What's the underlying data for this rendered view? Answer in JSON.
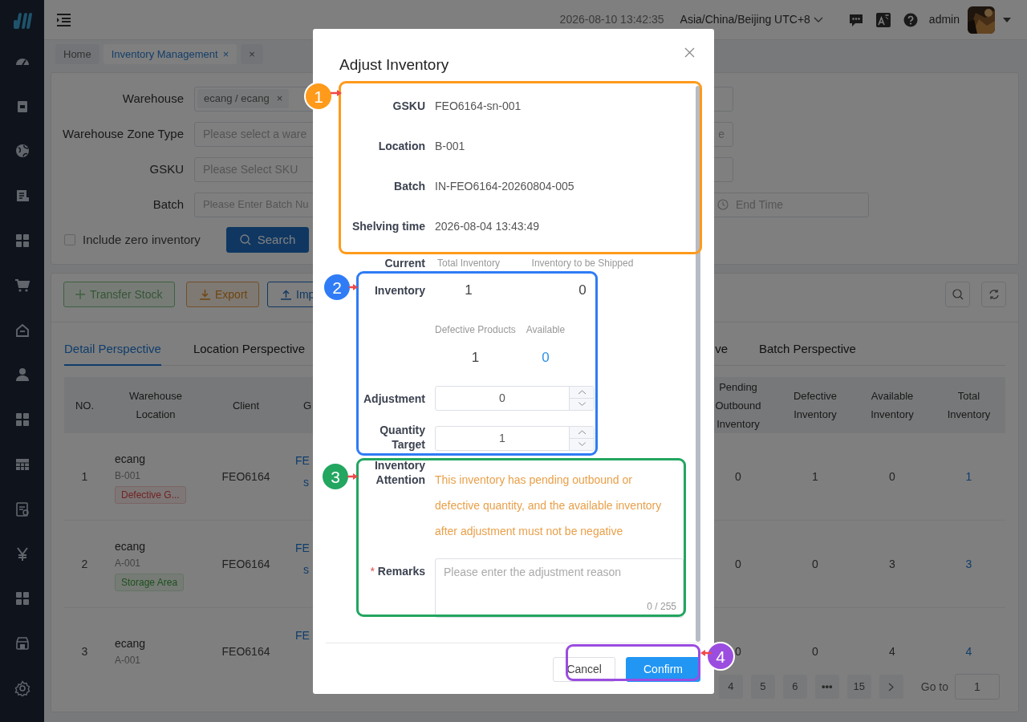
{
  "header": {
    "datetime": "2026-08-10 13:42:35",
    "timezone": "Asia/China/Beijing UTC+8",
    "user": "admin"
  },
  "page_tabs": [
    {
      "label": "Home",
      "selected": false
    },
    {
      "label": "Inventory Management",
      "selected": true,
      "close": "×"
    }
  ],
  "close_all": "×",
  "filters": {
    "fields": [
      {
        "label": "Warehouse",
        "kind": "tags",
        "tags": [
          "ecang / ecang"
        ],
        "tag_close": "×"
      },
      {
        "label": "Warehouse Zone Type",
        "kind": "select",
        "placeholder": "Please select a ware",
        "side_text": "e"
      },
      {
        "label": "GSKU",
        "kind": "select",
        "placeholder": "Please Select SKU"
      },
      {
        "label": "Batch",
        "kind": "date",
        "placeholder": "Please Enter Batch Nu",
        "end_placeholder": "End Time"
      }
    ],
    "include_zero": {
      "label": "Include zero inventory",
      "checked": false
    },
    "search": "Search"
  },
  "toolbar": [
    {
      "label": "Transfer Stock",
      "kind": "add",
      "disabled": true
    },
    {
      "label": "Export",
      "kind": "export",
      "disabled": false
    },
    {
      "label": "Imp",
      "kind": "import",
      "disabled": false
    }
  ],
  "view_tabs": [
    {
      "label": "Detail Perspective",
      "selected": true
    },
    {
      "label": "Location Perspective",
      "selected": false
    },
    {
      "label": "ve",
      "selected": false
    },
    {
      "label": "Batch Perspective",
      "selected": false
    }
  ],
  "table": {
    "columns": [
      "NO.",
      "Warehouse Location",
      "Client",
      "G",
      "Pending Outbound Inventory",
      "Defective Inventory",
      "Available Inventory",
      "Total Inventory"
    ],
    "rows": [
      {
        "no": "1",
        "warehouse": "ecang",
        "location": "B-001",
        "tag": {
          "text": "Defective G...",
          "kind": "danger"
        },
        "client": "FEO6164",
        "gsku": [
          "FE",
          "s"
        ],
        "pending": "0",
        "defective": "1",
        "available": "0",
        "total": "1"
      },
      {
        "no": "2",
        "warehouse": "ecang",
        "location": "A-001",
        "tag": {
          "text": "Storage Area",
          "kind": "success"
        },
        "client": "FEO6164",
        "gsku": [
          "FE",
          "s"
        ],
        "pending": "0",
        "defective": "0",
        "available": "3",
        "total": "3"
      },
      {
        "no": "3",
        "warehouse": "ecang",
        "location": "A-001",
        "client": "FEO6164",
        "gsku": [
          "FE"
        ],
        "pending": "0",
        "defective": "0",
        "available": "4",
        "total": "4"
      }
    ]
  },
  "pagination": {
    "pages": [
      {
        "label": "4",
        "kind": "page"
      },
      {
        "label": "5",
        "kind": "page"
      },
      {
        "label": "6",
        "kind": "page"
      },
      {
        "label": "•••",
        "kind": "more"
      },
      {
        "label": "15",
        "kind": "page"
      }
    ],
    "goto_label": "Go to",
    "goto_value": "1"
  },
  "modal": {
    "title": "Adjust Inventory",
    "details": [
      {
        "label": "GSKU",
        "value": "FEO6164-sn-001"
      },
      {
        "label": "Location",
        "value": "B-001"
      },
      {
        "label": "Batch",
        "value": "IN-FEO6164-20260804-005"
      },
      {
        "label": "Shelving time",
        "value": "2026-08-04 13:43:49"
      }
    ],
    "current": {
      "label_top": "Current",
      "label_bottom": "Inventory",
      "columns": [
        "Total Inventory",
        "Inventory to be Shipped"
      ],
      "values": [
        "1",
        "0"
      ]
    },
    "breakdown": {
      "columns": [
        "Defective Products",
        "Available"
      ],
      "values": [
        "1",
        "0"
      ]
    },
    "adjustment": {
      "label": "Adjustment",
      "value": "0"
    },
    "target": {
      "label": "Quantity Target",
      "value": "1"
    },
    "attention": {
      "label": "Inventory Attention",
      "text": "This inventory has pending outbound or defective quantity, and the available inventory after adjustment must not be negative"
    },
    "remarks": {
      "label": "Remarks",
      "required_mark": "*",
      "placeholder": "Please enter the adjustment reason",
      "counter": "0 / 255"
    },
    "buttons": [
      {
        "label": "Cancel",
        "kind": "default"
      },
      {
        "label": "Confirm",
        "kind": "primary"
      }
    ]
  },
  "annotations": [
    {
      "number": "1",
      "color": "#ff9a1a"
    },
    {
      "number": "2",
      "color": "#2f7cf6"
    },
    {
      "number": "3",
      "color": "#22a660"
    },
    {
      "number": "4",
      "color": "#9b4de0"
    }
  ]
}
